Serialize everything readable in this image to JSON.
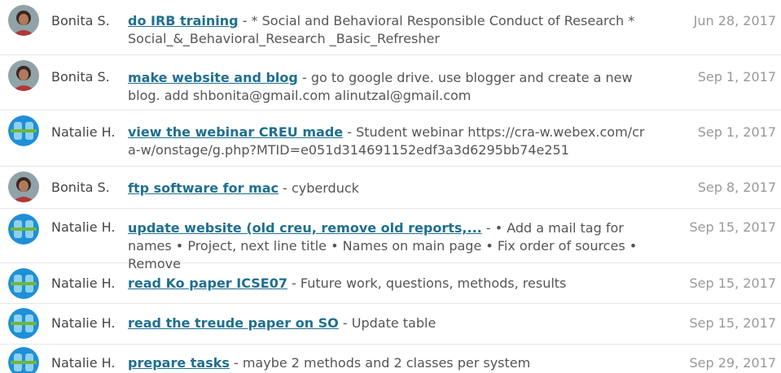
{
  "tasks": [
    {
      "owner": "Bonita S.",
      "avatar": "photo-avatar",
      "title": "do IRB training",
      "sep": " - ",
      "desc": "* Social and Behavioral Responsible Conduct of Research * Social_&_Behavioral_Research _Basic_Refresher",
      "date": "Jun 28, 2017"
    },
    {
      "owner": "Bonita S.",
      "avatar": "photo-avatar",
      "title": "make website and blog",
      "sep": " - ",
      "desc": "go to google drive. use blogger and create a new blog. add shbonita@gmail.com alinutzal@gmail.com",
      "date": "Sep 1, 2017"
    },
    {
      "owner": "Natalie H.",
      "avatar": "logo-avatar",
      "title": "view the webinar CREU made",
      "sep": " - ",
      "desc": "Student webinar https://cra-w.webex.com/cra-w/onstage/g.php?MTID=e051d314691152edf3a3d6295bb74e251",
      "date": "Sep 1, 2017"
    },
    {
      "owner": "Bonita S.",
      "avatar": "photo-avatar",
      "title": "ftp software for mac",
      "sep": " - ",
      "desc": "cyberduck",
      "date": "Sep 8, 2017"
    },
    {
      "owner": "Natalie H.",
      "avatar": "logo-avatar",
      "title": "update website (old creu, remove old reports,...",
      "sep": " - ",
      "desc": "• Add a mail tag for names • Project, next line title • Names on main page • Fix order of sources • Remove",
      "date": "Sep 15, 2017"
    },
    {
      "owner": "Natalie H.",
      "avatar": "logo-avatar",
      "title": "read Ko paper ICSE07",
      "sep": " - ",
      "desc": "Future work, questions, methods, results",
      "date": "Sep 15, 2017"
    },
    {
      "owner": "Natalie H.",
      "avatar": "logo-avatar",
      "title": "read the treude paper on SO",
      "sep": " - ",
      "desc": "Update table",
      "date": "Sep 15, 2017"
    },
    {
      "owner": "Natalie H.",
      "avatar": "logo-avatar",
      "title": "prepare tasks",
      "sep": " - ",
      "desc": "maybe 2 methods and 2 classes per system",
      "date": "Sep 29, 2017"
    }
  ]
}
